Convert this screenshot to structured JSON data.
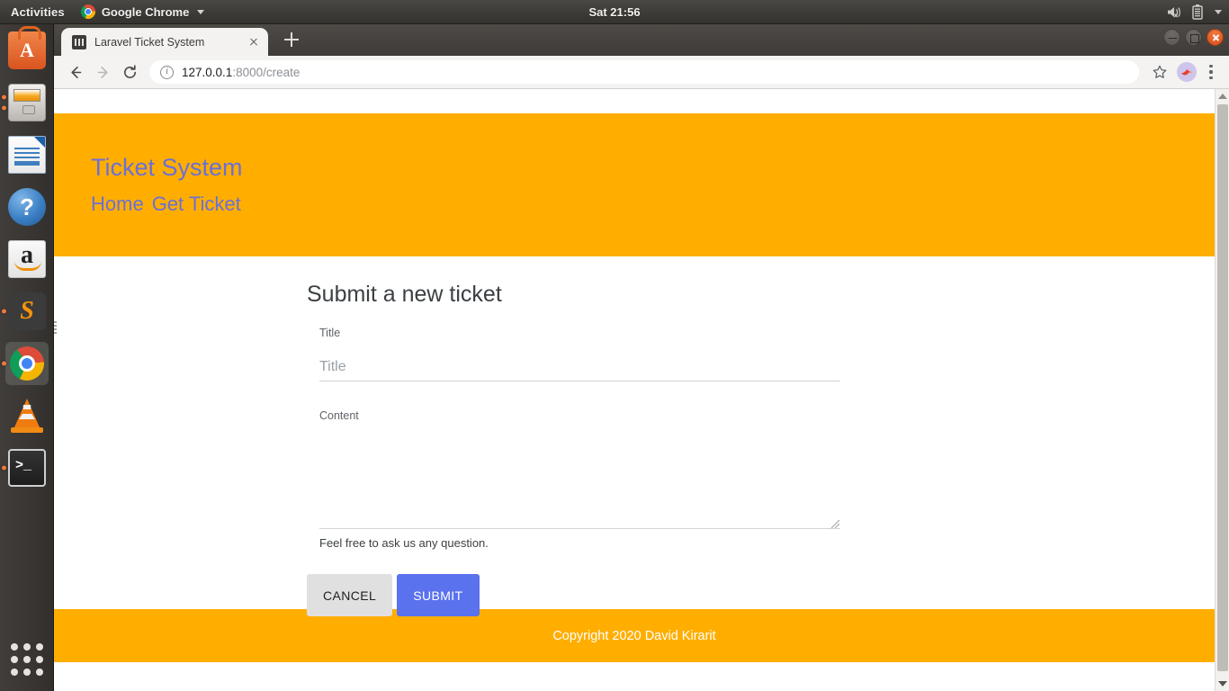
{
  "desktop": {
    "topbar": {
      "activities": "Activities",
      "app_name": "Google Chrome",
      "clock": "Sat 21:56",
      "tray": [
        {
          "icon": "volume-muted-icon"
        },
        {
          "icon": "battery-icon"
        },
        {
          "icon": "system-menu-caret-icon"
        }
      ]
    },
    "launcher": {
      "items": [
        {
          "name": "ubuntu-software",
          "icon": "software-center-icon",
          "running": false
        },
        {
          "name": "files",
          "icon": "file-manager-icon",
          "running": true
        },
        {
          "name": "libreoffice-writer",
          "icon": "writer-document-icon",
          "running": false
        },
        {
          "name": "help",
          "icon": "help-icon",
          "running": false
        },
        {
          "name": "amazon",
          "icon": "amazon-icon",
          "running": false
        },
        {
          "name": "sublime-text",
          "icon": "sublime-text-icon",
          "running": true
        },
        {
          "name": "google-chrome",
          "icon": "chrome-icon",
          "running": true
        },
        {
          "name": "vlc",
          "icon": "vlc-cone-icon",
          "running": false
        },
        {
          "name": "terminal",
          "icon": "terminal-icon",
          "running": true
        }
      ],
      "show_applications": "show-applications-grid-icon"
    }
  },
  "browser": {
    "tab": {
      "title": "Laravel Ticket System",
      "favicon": "laravel-favicon",
      "close": "close-tab-icon"
    },
    "new_tab": "new-tab-icon",
    "window_controls": {
      "minimize": "minimize-icon",
      "maximize": "maximize-icon",
      "close": "close-window-icon"
    },
    "toolbar": {
      "back": "back-arrow-icon",
      "forward": "forward-arrow-icon",
      "reload": "reload-icon",
      "site_info": "site-info-icon",
      "url_host": "127.0.0.1",
      "url_rest": ":8000/create",
      "url_full": "127.0.0.1:8000/create",
      "bookmark": "star-icon",
      "profile": "profile-avatar-icon",
      "menu": "chrome-menu-icon"
    }
  },
  "site": {
    "colors": {
      "brand": "#ffae00",
      "link": "#6b70d6",
      "accent": "#5a72ee",
      "cancel_bg": "#e0e0e0"
    },
    "header": {
      "title": "Ticket System",
      "nav": [
        {
          "label": "Home"
        },
        {
          "label": "Get Ticket"
        }
      ]
    },
    "form": {
      "heading": "Submit a new ticket",
      "title_field": {
        "label": "Title",
        "placeholder": "Title",
        "value": ""
      },
      "content_field": {
        "label": "Content",
        "placeholder": "",
        "value": "",
        "helper": "Feel free to ask us any question."
      },
      "buttons": {
        "cancel": "CANCEL",
        "submit": "SUBMIT"
      }
    },
    "footer": {
      "copyright": "Copyright 2020 David Kirarit"
    }
  }
}
